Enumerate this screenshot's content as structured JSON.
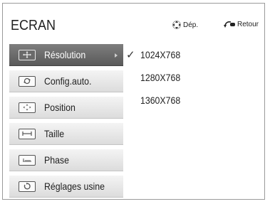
{
  "header": {
    "title": "ECRAN",
    "move_hint": "Dép.",
    "back_hint": "Retour"
  },
  "menu": {
    "items": [
      {
        "label": "Résolution",
        "icon": "move-icon",
        "selected": true
      },
      {
        "label": "Config.auto.",
        "icon": "auto-config-icon",
        "selected": false
      },
      {
        "label": "Position",
        "icon": "position-icon",
        "selected": false
      },
      {
        "label": "Taille",
        "icon": "size-icon",
        "selected": false
      },
      {
        "label": "Phase",
        "icon": "phase-icon",
        "selected": false
      },
      {
        "label": "Réglages usine",
        "icon": "reset-icon",
        "selected": false
      }
    ]
  },
  "options": {
    "items": [
      {
        "label": "1024X768",
        "checked": true
      },
      {
        "label": "1280X768",
        "checked": false
      },
      {
        "label": "1360X768",
        "checked": false
      }
    ],
    "check_glyph": "✓"
  },
  "colors": {
    "selected_bg": "#6b6b6b",
    "item_bg": "#e6e6e6",
    "text": "#222222"
  }
}
